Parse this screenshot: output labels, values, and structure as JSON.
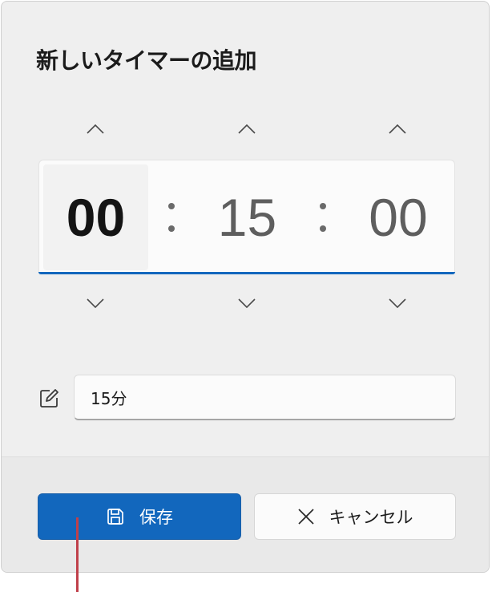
{
  "dialog": {
    "title": "新しいタイマーの追加"
  },
  "time": {
    "hours": "00",
    "minutes": "15",
    "seconds": "00",
    "separator": ":",
    "active_segment": "hours"
  },
  "icons": {
    "increment": "chevron-up-icon",
    "decrement": "chevron-down-icon",
    "rename": "edit-icon",
    "save": "save-icon",
    "cancel": "close-icon"
  },
  "name_field": {
    "value": "15分"
  },
  "buttons": {
    "save_label": "保存",
    "cancel_label": "キャンセル"
  },
  "colors": {
    "accent": "#1267bd",
    "pointer": "#c0404a"
  }
}
